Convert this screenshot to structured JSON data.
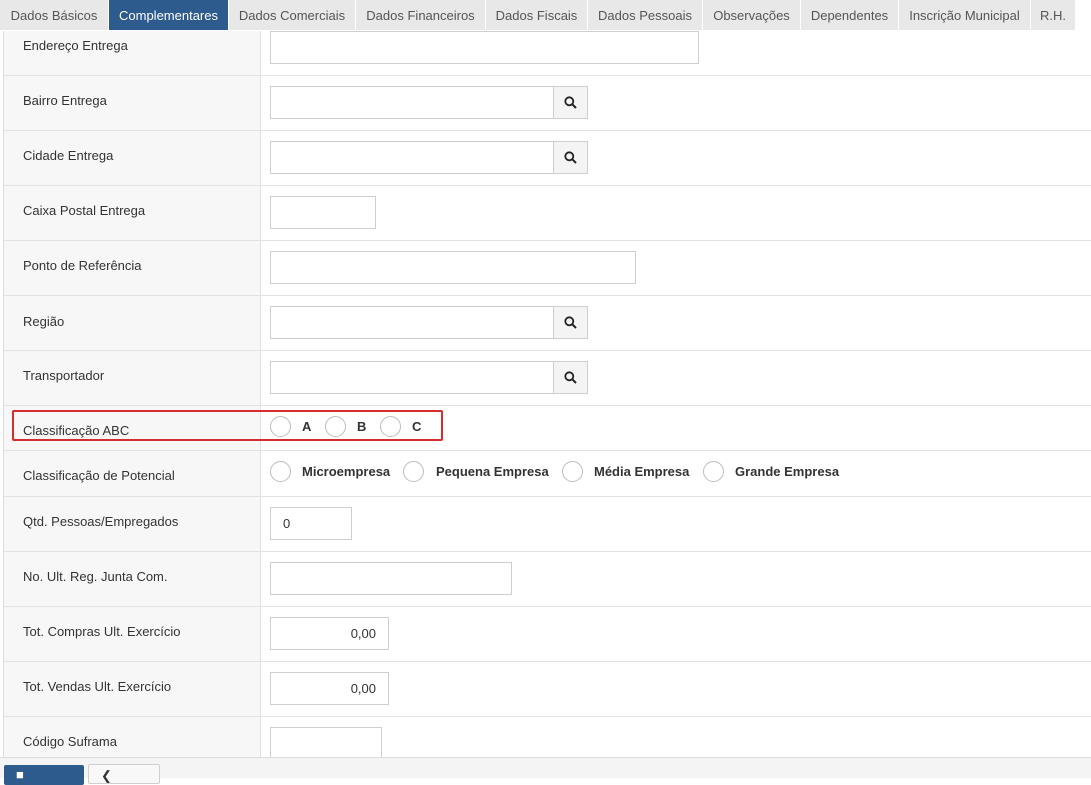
{
  "tabs": [
    "Dados Básicos",
    "Complementares",
    "Dados Comerciais",
    "Dados Financeiros",
    "Dados Fiscais",
    "Dados Pessoais",
    "Observações",
    "Dependentes",
    "Inscrição Municipal",
    "R.H."
  ],
  "active_tab": "Complementares",
  "fields": {
    "endereco_entrega": {
      "label": "Endereço Entrega",
      "value": ""
    },
    "bairro_entrega": {
      "label": "Bairro Entrega",
      "value": ""
    },
    "cidade_entrega": {
      "label": "Cidade Entrega",
      "value": ""
    },
    "caixa_postal_entrega": {
      "label": "Caixa Postal Entrega",
      "value": ""
    },
    "ponto_referencia": {
      "label": "Ponto de Referência",
      "value": ""
    },
    "regiao": {
      "label": "Região",
      "value": ""
    },
    "transportador": {
      "label": "Transportador",
      "value": ""
    },
    "classificacao_abc": {
      "label": "Classificação ABC",
      "options": [
        "A",
        "B",
        "C"
      ]
    },
    "classificacao_potencial": {
      "label": "Classificação de Potencial",
      "options": [
        "Microempresa",
        "Pequena Empresa",
        "Média Empresa",
        "Grande Empresa"
      ]
    },
    "qtd_pessoas": {
      "label": "Qtd. Pessoas/Empregados",
      "value": "0"
    },
    "no_ult_reg": {
      "label": "No. Ult. Reg. Junta Com.",
      "value": ""
    },
    "tot_compras": {
      "label": "Tot. Compras Ult. Exercício",
      "value": "0,00"
    },
    "tot_vendas": {
      "label": "Tot. Vendas Ult. Exercício",
      "value": "0,00"
    },
    "codigo_suframa": {
      "label": "Código Suframa",
      "value": ""
    }
  },
  "colors": {
    "active_tab": "#2e5b8e",
    "highlight": "#d62c2c"
  },
  "icons": {
    "search": "search-icon"
  }
}
